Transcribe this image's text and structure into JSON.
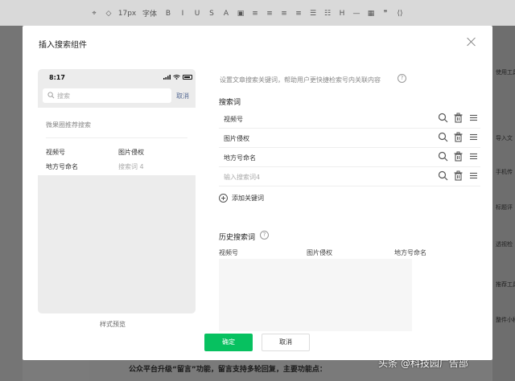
{
  "toolbar": {
    "font_size": "17px",
    "font_family": "字体",
    "items": [
      "B",
      "I",
      "U",
      "S",
      "A"
    ]
  },
  "right_sidebar": {
    "items": [
      "使用工具",
      "导入文",
      "手机传",
      "标题评",
      "透视检",
      "推荐工具",
      "整件小程"
    ]
  },
  "dialog": {
    "title": "插入搜索组件",
    "description": "设置文章搜索关键词，帮助用户更快捷检索号内关联内容",
    "keywords_section_title": "搜索词",
    "keywords": [
      {
        "text": "视频号"
      },
      {
        "text": "图片侵权"
      },
      {
        "text": "地方号命名"
      }
    ],
    "keyword_input_placeholder": "输入搜索词4",
    "add_keyword_label": "添加关键词",
    "history_section_title": "历史搜索词",
    "history_headers": [
      "视频号",
      "图片侵权",
      "地方号命名"
    ],
    "ok_label": "确定",
    "cancel_label": "取消"
  },
  "preview": {
    "time": "8:17",
    "search_placeholder": "搜索",
    "cancel_label": "取消",
    "recommend_title": "微果圈推荐搜索",
    "words": [
      "视频号",
      "图片侵权",
      "地方号命名",
      "搜索词 4"
    ],
    "label": "样式预览"
  },
  "background": {
    "bottom_text": "公众平台升级“留言”功能，留言支持多轮回复，主要功能点：",
    "watermark": "头条 @科技园广告部"
  },
  "colors": {
    "primary_green": "#07c160",
    "link_blue": "#576b95"
  }
}
